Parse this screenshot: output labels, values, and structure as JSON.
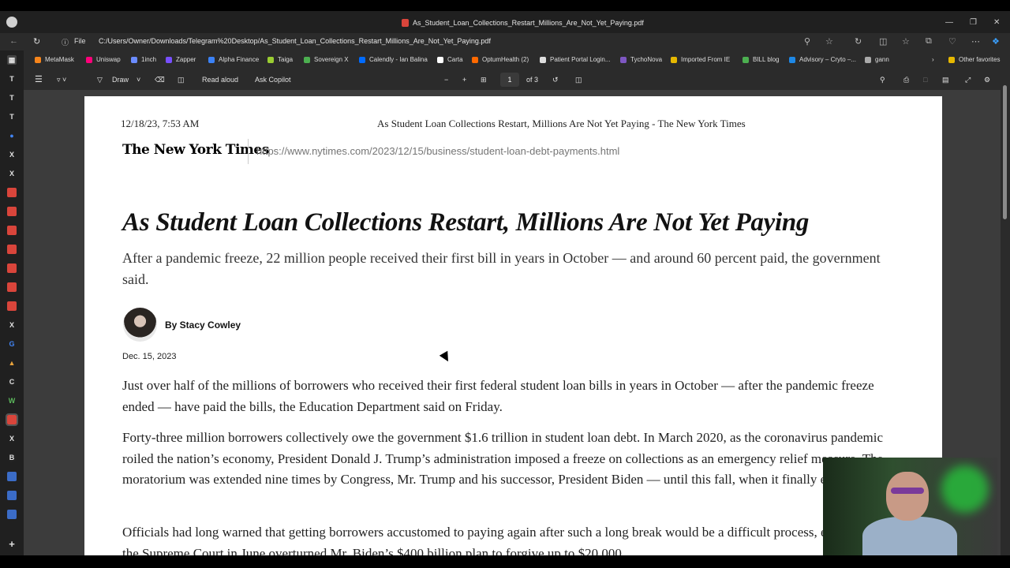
{
  "window": {
    "title": "As_Student_Loan_Collections_Restart_Millions_Are_Not_Yet_Paying.pdf"
  },
  "address_bar": {
    "file_label": "File",
    "url": "C:/Users/Owner/Downloads/Telegram%20Desktop/As_Student_Loan_Collections_Restart_Millions_Are_Not_Yet_Paying.pdf"
  },
  "favorites": [
    {
      "label": "MetaMask",
      "color": "#f6851b"
    },
    {
      "label": "Uniswap",
      "color": "#ff007a"
    },
    {
      "label": "1inch",
      "color": "#6b8cff"
    },
    {
      "label": "Zapper",
      "color": "#784ffe"
    },
    {
      "label": "Alpha Finance",
      "color": "#3b82f6"
    },
    {
      "label": "Taiga",
      "color": "#9acd32"
    },
    {
      "label": "Sovereign X",
      "color": "#4caf50"
    },
    {
      "label": "Calendly - Ian Balina",
      "color": "#006bff"
    },
    {
      "label": "Carta",
      "color": "#ffffff"
    },
    {
      "label": "OptumHealth (2)",
      "color": "#ff6900"
    },
    {
      "label": "Patient Portal Login...",
      "color": "#dddddd"
    },
    {
      "label": "TychoNova",
      "color": "#7e57c2"
    },
    {
      "label": "Imported From IE",
      "color": "#e6b800"
    },
    {
      "label": "BILL blog",
      "color": "#4caf50"
    },
    {
      "label": "Advisory – Cryto –...",
      "color": "#1e88e5"
    },
    {
      "label": "gann",
      "color": "#aaaaaa"
    }
  ],
  "favorites_other": "Other favorites",
  "pdf_toolbar": {
    "draw": "Draw",
    "read_aloud": "Read aloud",
    "ask_copilot": "Ask Copilot",
    "page_current": "1",
    "page_total": "of 3"
  },
  "pdf": {
    "header_date": "12/18/23, 7:53 AM",
    "header_title": "As Student Loan Collections Restart, Millions Are Not Yet Paying - The New York Times",
    "logo": "The New York Times",
    "link": "https://www.nytimes.com/2023/12/15/business/student-loan-debt-payments.html",
    "headline": "As Student Loan Collections Restart, Millions Are Not Yet Paying",
    "summary": "After a pandemic freeze, 22 million people received their first bill in years in October — and around 60 percent paid, the government said.",
    "byline": "By Stacy Cowley",
    "pubdate": "Dec. 15, 2023",
    "paragraphs": [
      "Just over half of the millions of borrowers who received their first federal student loan bills in years in October — after the pandemic freeze ended — have paid the bills, the Education Department said on Friday.",
      "Forty-three million borrowers collectively owe the government $1.6 trillion in student loan debt. In March 2020, as the coronavirus pandemic roiled the nation’s economy, President Donald J. Trump’s administration imposed a freeze on collections as an emergency relief measure. The moratorium was extended nine times by Congress, Mr. Trump and his successor, President Biden — until this fall, when it finally ended.",
      "Officials had long warned that getting borrowers accustomed to paying again after such a long break would be a difficult process, especially after the Supreme Court in June overturned Mr. Biden’s $400 billion plan to forgive up to $20,000"
    ]
  }
}
